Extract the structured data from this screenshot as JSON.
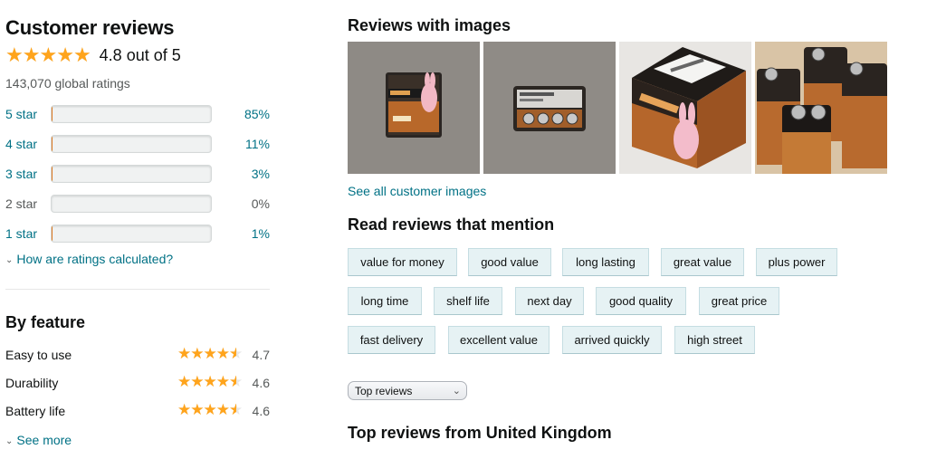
{
  "customer_reviews": {
    "title": "Customer reviews",
    "average_stars": 4.8,
    "rating_text": "4.8 out of 5",
    "global_ratings": "143,070 global ratings",
    "histogram": [
      {
        "label": "5 star",
        "percent": 85,
        "percent_text": "85%"
      },
      {
        "label": "4 star",
        "percent": 11,
        "percent_text": "11%"
      },
      {
        "label": "3 star",
        "percent": 3,
        "percent_text": "3%"
      },
      {
        "label": "2 star",
        "percent": 0,
        "percent_text": "0%"
      },
      {
        "label": "1 star",
        "percent": 1,
        "percent_text": "1%"
      }
    ],
    "how_calculated": "How are ratings calculated?"
  },
  "by_feature": {
    "title": "By feature",
    "features": [
      {
        "name": "Easy to use",
        "rating": 4.7,
        "rating_text": "4.7"
      },
      {
        "name": "Durability",
        "rating": 4.6,
        "rating_text": "4.6"
      },
      {
        "name": "Battery life",
        "rating": 4.6,
        "rating_text": "4.6"
      }
    ],
    "see_more": "See more"
  },
  "reviews_with_images": {
    "title": "Reviews with images",
    "see_all": "See all customer images"
  },
  "mentions": {
    "title": "Read reviews that mention",
    "chips": [
      [
        "value for money",
        "good value",
        "long lasting",
        "great value",
        "plus power"
      ],
      [
        "long time",
        "shelf life",
        "next day",
        "good quality",
        "great price"
      ],
      [
        "fast delivery",
        "excellent value",
        "arrived quickly",
        "high street"
      ]
    ]
  },
  "sort": {
    "selected": "Top reviews"
  },
  "top_reviews": {
    "title": "Top reviews from United Kingdom"
  },
  "colors": {
    "star": "#ffa41c",
    "link": "#007185",
    "chip_bg": "#e6f2f4",
    "bar_fill": "#ffa41c"
  }
}
